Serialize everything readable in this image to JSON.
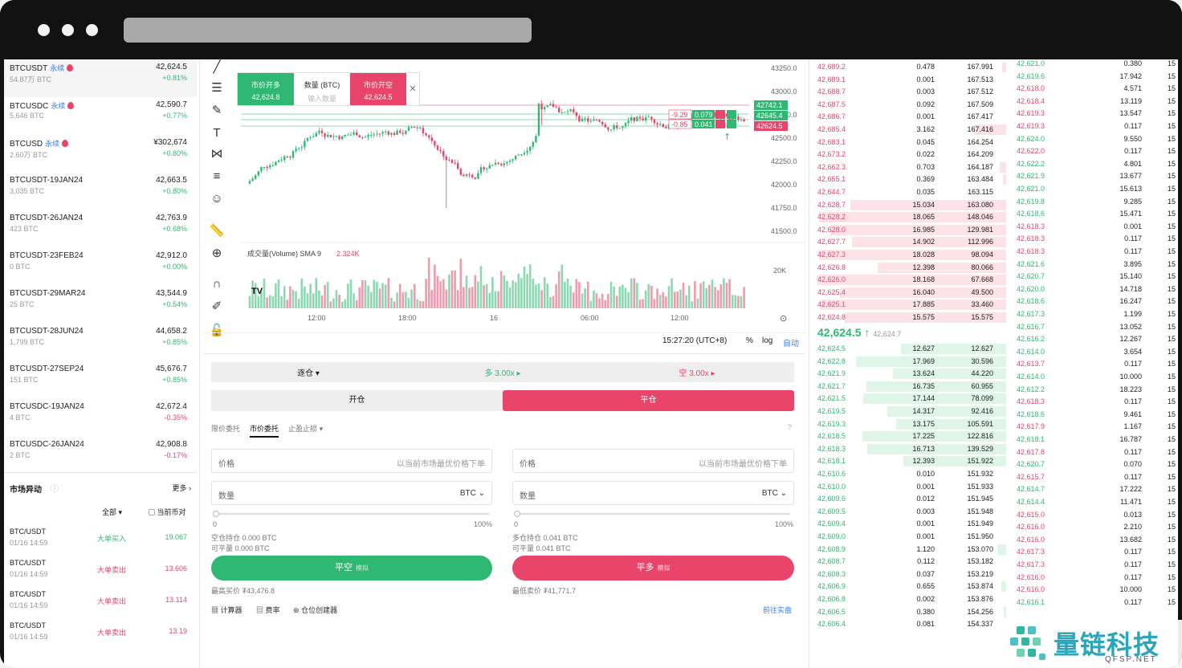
{
  "markets": [
    {
      "symbol": "BTCUSDT",
      "tag": "永续",
      "hot": true,
      "volume": "54.87万 BTC",
      "price": "42,624.5",
      "change": "+0.81%",
      "up": true
    },
    {
      "symbol": "BTCUSDC",
      "tag": "永续",
      "hot": true,
      "volume": "5,646 BTC",
      "price": "42,590.7",
      "change": "+0.77%",
      "up": true
    },
    {
      "symbol": "BTCUSD",
      "tag": "永续",
      "hot": true,
      "volume": "2.60万 BTC",
      "price": "¥302,674",
      "change": "+0.80%",
      "up": true
    },
    {
      "symbol": "BTCUSDT-19JAN24",
      "tag": "",
      "hot": false,
      "volume": "3,035 BTC",
      "price": "42,663.5",
      "change": "+0.80%",
      "up": true
    },
    {
      "symbol": "BTCUSDT-26JAN24",
      "tag": "",
      "hot": false,
      "volume": "423 BTC",
      "price": "42,763.9",
      "change": "+0.68%",
      "up": true
    },
    {
      "symbol": "BTCUSDT-23FEB24",
      "tag": "",
      "hot": false,
      "volume": "0 BTC",
      "price": "42,912.0",
      "change": "+0.00%",
      "up": true
    },
    {
      "symbol": "BTCUSDT-29MAR24",
      "tag": "",
      "hot": false,
      "volume": "25 BTC",
      "price": "43,544.9",
      "change": "+0.54%",
      "up": true
    },
    {
      "symbol": "BTCUSDT-28JUN24",
      "tag": "",
      "hot": false,
      "volume": "1,799 BTC",
      "price": "44,658.2",
      "change": "+0.85%",
      "up": true
    },
    {
      "symbol": "BTCUSDT-27SEP24",
      "tag": "",
      "hot": false,
      "volume": "151 BTC",
      "price": "45,676.7",
      "change": "+0.85%",
      "up": true
    },
    {
      "symbol": "BTCUSDC-19JAN24",
      "tag": "",
      "hot": false,
      "volume": "4 BTC",
      "price": "42,672.4",
      "change": "-0.35%",
      "up": false
    },
    {
      "symbol": "BTCUSDC-26JAN24",
      "tag": "",
      "hot": false,
      "volume": "2 BTC",
      "price": "42,908.8",
      "change": "-0.17%",
      "up": false
    }
  ],
  "market_moves": {
    "title": "市场异动",
    "more": "更多",
    "filter_all": "全部",
    "filter_current": "当前币对",
    "events": [
      {
        "symbol": "BTC/USDT",
        "time": "01/16 14:59",
        "kind": "大单买入",
        "qty": "19.067",
        "buy": true
      },
      {
        "symbol": "BTC/USDT",
        "time": "01/16 14:59",
        "kind": "大单卖出",
        "qty": "13.606",
        "buy": false
      },
      {
        "symbol": "BTC/USDT",
        "time": "01/16 14:59",
        "kind": "大单卖出",
        "qty": "13.114",
        "buy": false
      },
      {
        "symbol": "BTC/USDT",
        "time": "01/16 14:59",
        "kind": "大单卖出",
        "qty": "13.19",
        "buy": false
      }
    ]
  },
  "quick_order": {
    "buy_label": "市价开多",
    "buy_price": "42,624.8",
    "qty_label": "数量 (BTC)",
    "qty_placeholder": "输入数量",
    "sell_label": "市价开空",
    "sell_price": "42,624.5"
  },
  "chart": {
    "y_ticks": [
      "43250.0",
      "43000.0",
      "42750.0",
      "42500.0",
      "42250.0",
      "42000.0",
      "41750.0",
      "41500.0"
    ],
    "x_ticks": [
      "12:00",
      "18:00",
      "16",
      "06:00",
      "12:00"
    ],
    "volume_label": "成交量(Volume) SMA 9",
    "volume_value": "2.324K",
    "volume_axis": "20K",
    "time": "15:27:20 (UTC+8)",
    "pct": "%",
    "log": "log",
    "auto": "自动",
    "price_tags": [
      "42742.1",
      "42645.4",
      "42624.5"
    ],
    "pos_tags": [
      {
        "pnl": "-9.29",
        "qty": "0.079"
      },
      {
        "pnl": "-0.85",
        "qty": "0.041"
      }
    ],
    "colors": {
      "up": "#2eb872",
      "down": "#e9456b"
    }
  },
  "form": {
    "margin_mode": "逐仓",
    "long_leverage": "多 3.00x",
    "short_leverage": "空 3.00x",
    "open_tab": "开仓",
    "close_tab": "平仓",
    "order_types": [
      "限价委托",
      "市价委托",
      "止盈止损"
    ],
    "price_label": "价格",
    "price_hint": "以当前市场最优价格下单",
    "qty_label": "数量",
    "unit": "BTC",
    "pct_min": "0",
    "pct_max": "100%",
    "left_info": [
      "空仓持仓 0.000 BTC",
      "可平量 0.000 BTC"
    ],
    "right_info": [
      "多仓持仓 0.041 BTC",
      "可平量 0.041 BTC"
    ],
    "close_short": "平空",
    "close_long": "平多",
    "sim": "模拟",
    "max_buy": "最高买价 ₮43,476.8",
    "min_sell": "最低卖价 ₮41,771.7",
    "tools": [
      "计算器",
      "费率",
      "仓位创建器"
    ],
    "go_live": "前往实盘"
  },
  "asks": [
    [
      "42,689.2",
      "0.478",
      "167.991"
    ],
    [
      "42,689.1",
      "0.001",
      "167.513"
    ],
    [
      "42,688.7",
      "0.003",
      "167.512"
    ],
    [
      "42,687.5",
      "0.092",
      "167.509"
    ],
    [
      "42,686.7",
      "0.001",
      "167.417"
    ],
    [
      "42,685.4",
      "3.162",
      "167.416"
    ],
    [
      "42,683.1",
      "0.045",
      "164.254"
    ],
    [
      "42,673.2",
      "0.022",
      "164.209"
    ],
    [
      "42,662.3",
      "0.703",
      "164.187"
    ],
    [
      "42,655.1",
      "0.369",
      "163.484"
    ],
    [
      "42,644.7",
      "0.035",
      "163.115"
    ],
    [
      "42,628.7",
      "15.034",
      "163.080"
    ],
    [
      "42,628.2",
      "18.065",
      "148.046"
    ],
    [
      "42,628.0",
      "16.985",
      "129.981"
    ],
    [
      "42,627.7",
      "14.902",
      "112.996"
    ],
    [
      "42,627.3",
      "18.028",
      "98.094"
    ],
    [
      "42,626.8",
      "12.398",
      "80.066"
    ],
    [
      "42,626.0",
      "18.168",
      "67.668"
    ],
    [
      "42,625.4",
      "16.040",
      "49.500"
    ],
    [
      "42,625.1",
      "17.885",
      "33.460"
    ],
    [
      "42,624.8",
      "15.575",
      "15.575"
    ]
  ],
  "mid_price": "42,624.5",
  "mid_sub": "42,624.7",
  "bids": [
    [
      "42,624.5",
      "12.627",
      "12.627"
    ],
    [
      "42,622.8",
      "17.969",
      "30.596"
    ],
    [
      "42,621.9",
      "13.624",
      "44.220"
    ],
    [
      "42,621.7",
      "16.735",
      "60.955"
    ],
    [
      "42,621.5",
      "17.144",
      "78.099"
    ],
    [
      "42,619.5",
      "14.317",
      "92.416"
    ],
    [
      "42,619.3",
      "13.175",
      "105.591"
    ],
    [
      "42,618.5",
      "17.225",
      "122.816"
    ],
    [
      "42,618.3",
      "16.713",
      "139.529"
    ],
    [
      "42,618.1",
      "12.393",
      "151.922"
    ],
    [
      "42,610.6",
      "0.010",
      "151.932"
    ],
    [
      "42,610.0",
      "0.001",
      "151.933"
    ],
    [
      "42,609.6",
      "0.012",
      "151.945"
    ],
    [
      "42,609.5",
      "0.003",
      "151.948"
    ],
    [
      "42,609.4",
      "0.001",
      "151.949"
    ],
    [
      "42,609.0",
      "0.001",
      "151.950"
    ],
    [
      "42,608.9",
      "1.120",
      "153.070"
    ],
    [
      "42,608.7",
      "0.112",
      "153.182"
    ],
    [
      "42,608.3",
      "0.037",
      "153.219"
    ],
    [
      "42,606.9",
      "0.655",
      "153.874"
    ],
    [
      "42,606.8",
      "0.002",
      "153.876"
    ],
    [
      "42,606.5",
      "0.380",
      "154.256"
    ],
    [
      "42,606.4",
      "0.081",
      "154.337"
    ]
  ],
  "trades": [
    [
      "42,621.0",
      "g",
      "0.380",
      "15"
    ],
    [
      "42,619.6",
      "g",
      "17.942",
      "15"
    ],
    [
      "42,618.0",
      "r",
      "4.571",
      "15"
    ],
    [
      "42,618.4",
      "r",
      "13.119",
      "15"
    ],
    [
      "42,619.3",
      "r",
      "13.547",
      "15"
    ],
    [
      "42,619.3",
      "r",
      "0.117",
      "15"
    ],
    [
      "42,624.0",
      "g",
      "9.550",
      "15"
    ],
    [
      "42,622.0",
      "r",
      "0.117",
      "15"
    ],
    [
      "42,622.2",
      "g",
      "4.801",
      "15"
    ],
    [
      "42,621.9",
      "g",
      "13.677",
      "15"
    ],
    [
      "42,621.0",
      "g",
      "15.613",
      "15"
    ],
    [
      "42,619.8",
      "g",
      "9.285",
      "15"
    ],
    [
      "42,618.6",
      "g",
      "15.471",
      "15"
    ],
    [
      "42,618.3",
      "r",
      "0.001",
      "15"
    ],
    [
      "42,618.3",
      "r",
      "0.117",
      "15"
    ],
    [
      "42,618.3",
      "r",
      "0.117",
      "15"
    ],
    [
      "42,621.6",
      "g",
      "3.895",
      "15"
    ],
    [
      "42,620.7",
      "g",
      "15.140",
      "15"
    ],
    [
      "42,620.0",
      "g",
      "14.718",
      "15"
    ],
    [
      "42,618.6",
      "g",
      "16.247",
      "15"
    ],
    [
      "42,617.3",
      "g",
      "1.199",
      "15"
    ],
    [
      "42,616.7",
      "g",
      "13.052",
      "15"
    ],
    [
      "42,616.2",
      "g",
      "12.267",
      "15"
    ],
    [
      "42,614.0",
      "g",
      "3.654",
      "15"
    ],
    [
      "42,613.7",
      "r",
      "0.117",
      "15"
    ],
    [
      "42,614.0",
      "g",
      "10.000",
      "15"
    ],
    [
      "42,612.2",
      "g",
      "18.223",
      "15"
    ],
    [
      "42,618.3",
      "r",
      "0.117",
      "15"
    ],
    [
      "42,618.6",
      "g",
      "9.461",
      "15"
    ],
    [
      "42,617.9",
      "r",
      "1.167",
      "15"
    ],
    [
      "42,618.1",
      "g",
      "16.787",
      "15"
    ],
    [
      "42,617.8",
      "r",
      "0.117",
      "15"
    ],
    [
      "42,620.7",
      "g",
      "0.070",
      "15"
    ],
    [
      "42,615.7",
      "r",
      "0.117",
      "15"
    ],
    [
      "42,614.7",
      "g",
      "17.222",
      "15"
    ],
    [
      "42,614.4",
      "g",
      "11.471",
      "15"
    ],
    [
      "42,615.0",
      "r",
      "0.013",
      "15"
    ],
    [
      "42,616.0",
      "r",
      "2.210",
      "15"
    ],
    [
      "42,616.0",
      "r",
      "13.682",
      "15"
    ],
    [
      "42,617.3",
      "r",
      "0.117",
      "15"
    ],
    [
      "42,617.3",
      "r",
      "0.117",
      "15"
    ],
    [
      "42,616.0",
      "r",
      "0.117",
      "15"
    ],
    [
      "42,616.0",
      "r",
      "10.000",
      "15"
    ],
    [
      "42,616.1",
      "g",
      "0.117",
      "15"
    ]
  ],
  "logo": {
    "text": "量链科技",
    "sub": "QFSP.NET"
  }
}
